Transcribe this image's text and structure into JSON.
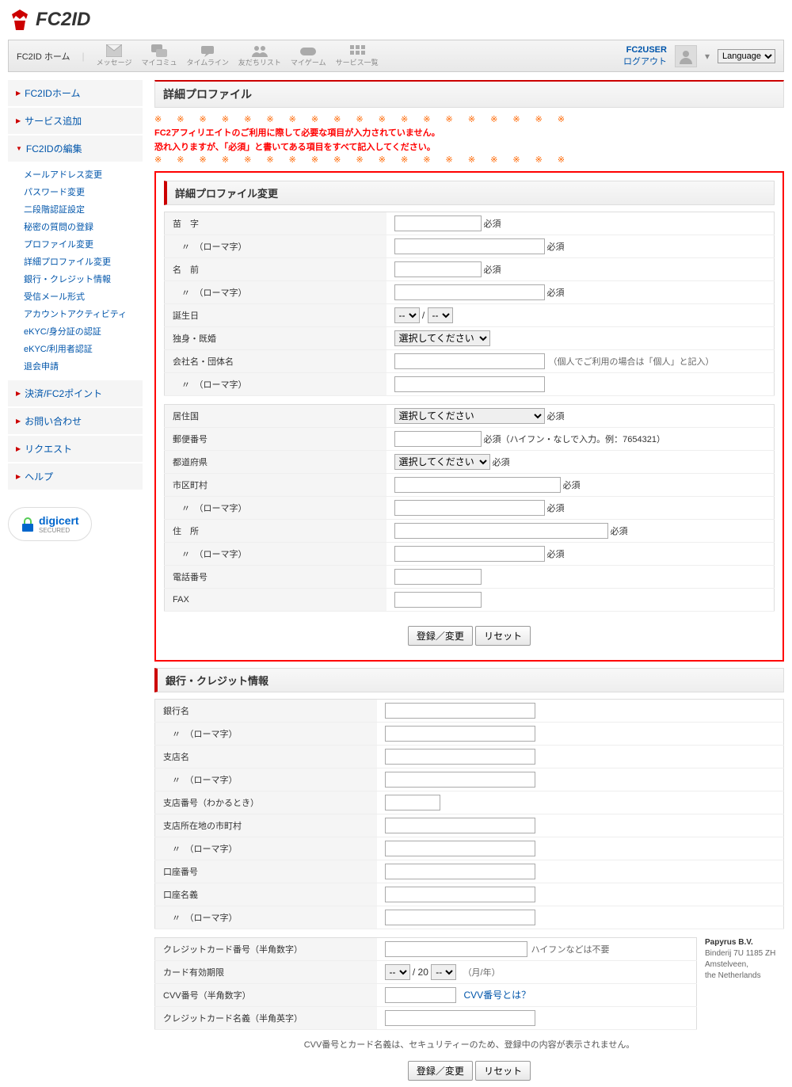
{
  "logo": {
    "text": "FC2ID"
  },
  "topnav": {
    "home": "FC2ID ホーム",
    "icons": [
      "メッセージ",
      "マイコミュ",
      "タイムライン",
      "友だちリスト",
      "マイゲーム",
      "サービス一覧"
    ],
    "user": "FC2USER",
    "logout": "ログアウト",
    "lang": "Language"
  },
  "sidebar": {
    "home": "FC2IDホーム",
    "add": "サービス追加",
    "edit": "FC2IDの編集",
    "sub": [
      "メールアドレス変更",
      "パスワード変更",
      "二段階認証設定",
      "秘密の質問の登録",
      "プロファイル変更",
      "詳細プロファイル変更",
      "銀行・クレジット情報",
      "受信メール形式",
      "アカウントアクティビティ",
      "eKYC/身分証の認証",
      "eKYC/利用者認証",
      "退会申請"
    ],
    "payment": "決済/FC2ポイント",
    "contact": "お問い合わせ",
    "request": "リクエスト",
    "help": "ヘルプ"
  },
  "digicert": {
    "brand": "digicert",
    "sub": "SECURED"
  },
  "page_title": "詳細プロファイル",
  "warning_stars": "※ ※ ※ ※ ※ ※ ※ ※ ※ ※ ※ ※ ※ ※ ※ ※ ※ ※ ※",
  "warning1": "FC2アフィリエイトのご利用に際して必要な項目が入力されていません。",
  "warning2": "恐れ入りますが、「必須」と書いてある項目をすべて記入してください。",
  "section1_title": "詳細プロファイル変更",
  "labels": {
    "lastname": "苗　字",
    "roman": "　〃　（ローマ字）",
    "firstname": "名　前",
    "birthday": "誕生日",
    "marital": "独身・既婚",
    "company": "会社名・団体名",
    "country": "居住国",
    "postal": "郵便番号",
    "prefecture": "都道府県",
    "city": "市区町村",
    "address": "住　所",
    "phone": "電話番号",
    "fax": "FAX",
    "req": "必須",
    "company_hint": "（個人でご利用の場合は「個人」と記入）",
    "postal_hint": "必須（ハイフン・なしで入力。例：7654321）",
    "select_placeholder": "選択してください",
    "dash": "--",
    "slash": " / "
  },
  "buttons": {
    "submit": "登録／変更",
    "reset": "リセット"
  },
  "section2_title": "銀行・クレジット情報",
  "bank": {
    "name": "銀行名",
    "branch": "支店名",
    "branch_no": "支店番号（わかるとき）",
    "branch_city": "支店所在地の市町村",
    "account_no": "口座番号",
    "account_name": "口座名義"
  },
  "credit": {
    "card_no": "クレジットカード番号（半角数字）",
    "card_no_hint": "ハイフンなどは不要",
    "expiry": "カード有効期限",
    "expiry_suffix": "（月/年）",
    "cvv": "CVV番号（半角数字）",
    "cvv_link": "CVV番号とは？",
    "card_name": "クレジットカード名義（半角英字）",
    "twenty": "20"
  },
  "note": "CVV番号とカード名義は、セキュリティーのため、登録中の内容が表示されません。",
  "company": {
    "name": "Papyrus B.V.",
    "addr1": "Binderij 7U 1185 ZH",
    "addr2": "Amstelveen,",
    "addr3": "the Netherlands"
  }
}
